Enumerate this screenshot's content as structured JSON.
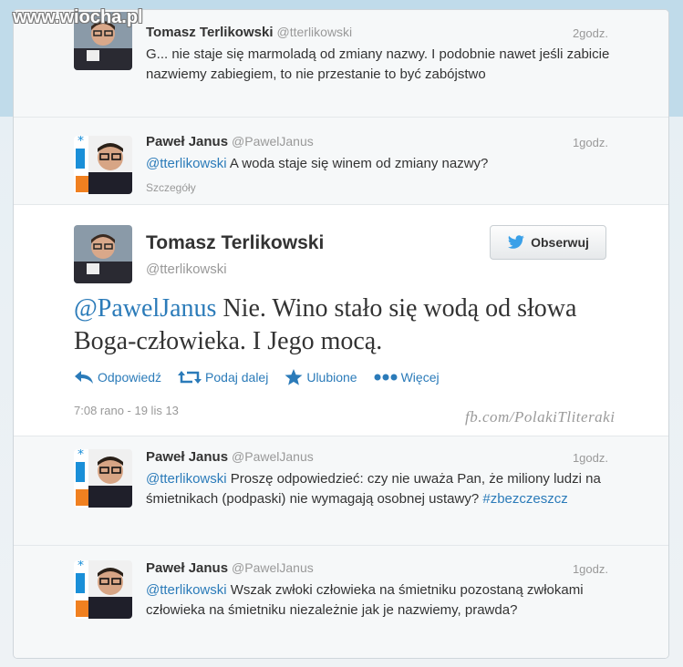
{
  "watermark": "www.wiocha.pl",
  "watermark2": "fb.com/PolakiTliteraki",
  "tweets": [
    {
      "name": "Tomasz Terlikowski",
      "handle": "@tterlikowski",
      "time": "2godz.",
      "text": "G... nie staje się marmoladą od zmiany nazwy. I podobnie nawet jeśli zabicie nazwiemy zabiegiem, to nie przestanie to być zabójstwo"
    },
    {
      "name": "Paweł Janus",
      "handle": "@PawelJanus",
      "time": "1godz.",
      "mention": "@tterlikowski",
      "text": " A woda staje się winem od zmiany nazwy?",
      "details": "Szczegóły"
    }
  ],
  "main_tweet": {
    "name": "Tomasz Terlikowski",
    "handle": "@tterlikowski",
    "follow": "Obserwuj",
    "mention": "@PawelJanus",
    "text": " Nie. Wino stało się wodą od słowa Boga-człowieka. I Jego mocą.",
    "actions": {
      "reply": "Odpowiedź",
      "retweet": "Podaj dalej",
      "favorite": "Ulubione",
      "more": "Więcej"
    },
    "timestamp": "7:08 rano - 19 lis 13"
  },
  "replies": [
    {
      "name": "Paweł Janus",
      "handle": "@PawelJanus",
      "time": "1godz.",
      "mention": "@tterlikowski",
      "text": " Proszę odpowiedzieć: czy nie uważa Pan, że miliony ludzi na śmietnikach (podpaski) nie wymagają osobnej ustawy? ",
      "hashtag": "#zbezczeszcz"
    },
    {
      "name": "Paweł Janus",
      "handle": "@PawelJanus",
      "time": "1godz.",
      "mention": "@tterlikowski",
      "text": " Wszak zwłoki człowieka na śmietniku pozostaną zwłokami człowieka na śmietniku niezależnie jak je nazwiemy, prawda?"
    }
  ],
  "colors": {
    "link": "#2b7bb9",
    "background_top": "#c0dbea"
  }
}
